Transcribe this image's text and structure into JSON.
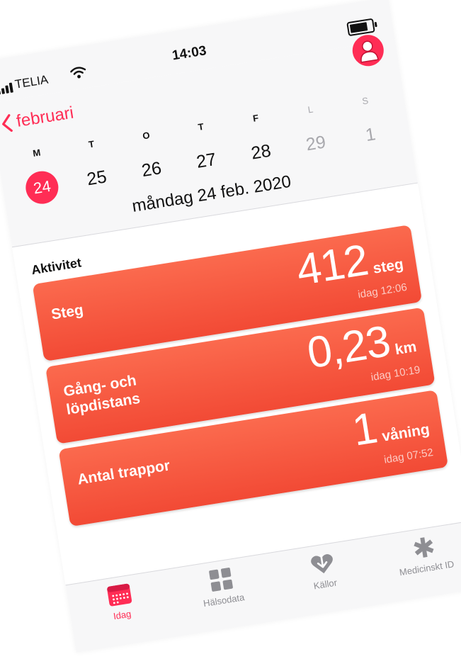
{
  "status_bar": {
    "carrier": "TELIA",
    "time": "14:03",
    "battery_level": 0.85
  },
  "header": {
    "back_label": "februari",
    "weekdays": [
      "M",
      "T",
      "O",
      "T",
      "F",
      "L",
      "S"
    ],
    "dates": [
      "24",
      "25",
      "26",
      "27",
      "28",
      "29",
      "1"
    ],
    "selected_index": 0,
    "full_date": "måndag 24 feb. 2020"
  },
  "section": {
    "title": "Aktivitet"
  },
  "cards": [
    {
      "title": "Steg",
      "value": "412",
      "unit": "steg",
      "time": "idag 12:06"
    },
    {
      "title": "Gång- och löpdistans",
      "value": "0,23",
      "unit": "km",
      "time": "idag 10:19"
    },
    {
      "title": "Antal trappor",
      "value": "1",
      "unit": "våning",
      "time": "idag 07:52"
    }
  ],
  "tabs": [
    {
      "label": "Idag",
      "icon": "calendar-icon",
      "active": true
    },
    {
      "label": "Hälsodata",
      "icon": "grid-icon",
      "active": false
    },
    {
      "label": "Källor",
      "icon": "heart-download-icon",
      "active": false
    },
    {
      "label": "Medicinskt ID",
      "icon": "asterisk-icon",
      "active": false
    }
  ],
  "colors": {
    "accent": "#ff2d55",
    "card": "#f55a40"
  }
}
